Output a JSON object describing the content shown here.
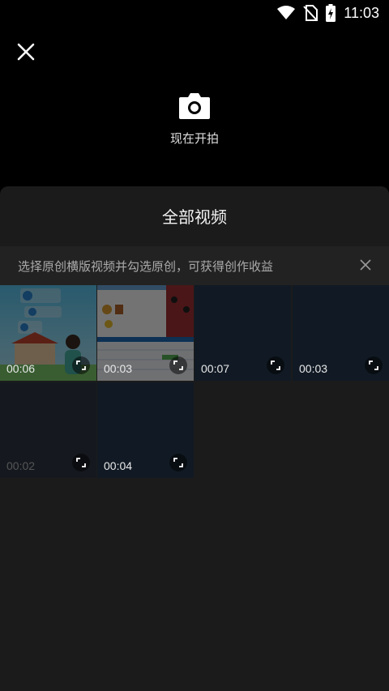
{
  "status": {
    "time": "11:03"
  },
  "camera": {
    "label": "现在开拍"
  },
  "sheet": {
    "title": "全部视频",
    "tip": "选择原创横版视频并勾选原创，可获得创作收益"
  },
  "videos": [
    {
      "duration": "00:06"
    },
    {
      "duration": "00:03"
    },
    {
      "duration": "00:07"
    },
    {
      "duration": "00:03"
    },
    {
      "duration": "00:02"
    },
    {
      "duration": "00:04"
    }
  ]
}
